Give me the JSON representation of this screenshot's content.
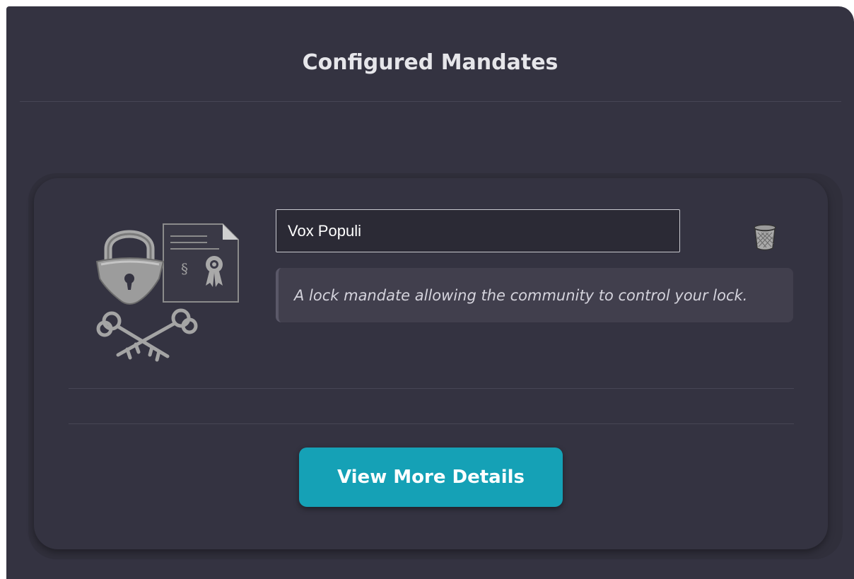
{
  "header": {
    "title": "Configured Mandates"
  },
  "mandate": {
    "name_value": "Vox Populi",
    "description": "A lock mandate allowing the community to control your lock.",
    "image_icon": "lock-mandate-icon",
    "delete_icon": "trash-icon"
  },
  "actions": {
    "details_label": "View More Details"
  },
  "colors": {
    "panel": "#343341",
    "card_outer": "#302f3b",
    "description_bg": "#413f4d",
    "accent_button": "#15a1b6",
    "title_text": "#e6e6ea"
  }
}
